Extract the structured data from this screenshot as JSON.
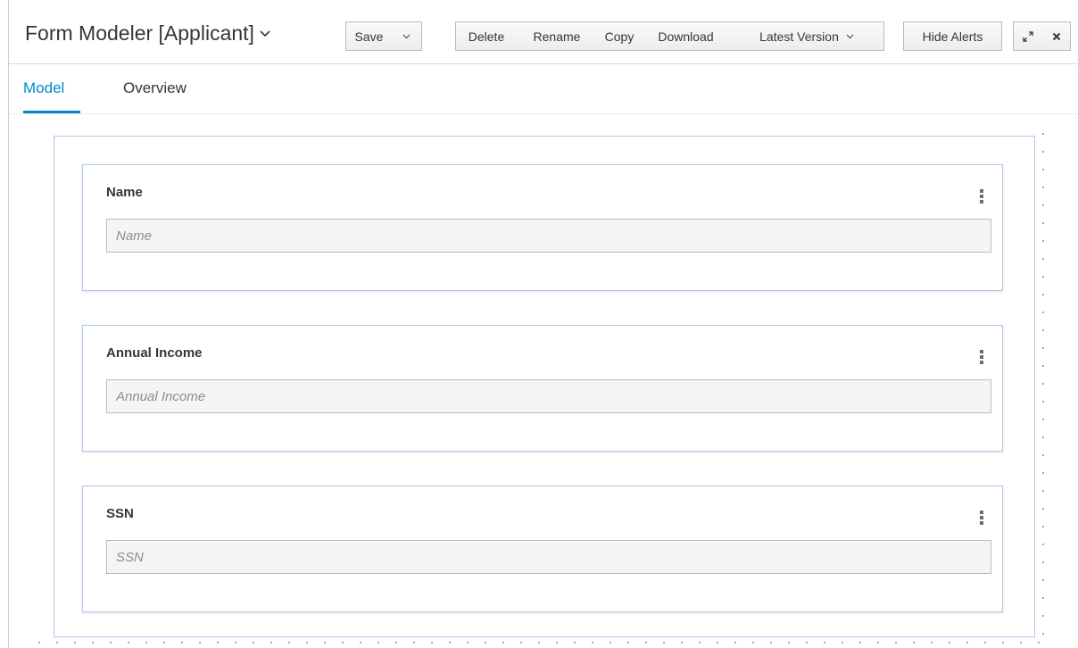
{
  "header": {
    "title": "Form Modeler [Applicant]",
    "buttons": {
      "save": "Save",
      "delete": "Delete",
      "rename": "Rename",
      "copy": "Copy",
      "download": "Download",
      "latest_version": "Latest Version",
      "hide_alerts": "Hide Alerts"
    },
    "icons": {
      "title_dropdown": "chevron-down-icon",
      "save_dropdown": "chevron-down-icon",
      "version_dropdown": "chevron-down-icon",
      "maximize": "expand-icon",
      "close": "close-icon"
    }
  },
  "tabs": [
    {
      "label": "Model",
      "active": true
    },
    {
      "label": "Overview",
      "active": false
    }
  ],
  "form": {
    "fields": [
      {
        "label": "Name",
        "placeholder": "Name"
      },
      {
        "label": "Annual Income",
        "placeholder": "Annual Income"
      },
      {
        "label": "SSN",
        "placeholder": "SSN"
      }
    ]
  },
  "colors": {
    "accent": "#0088ce",
    "card_border": "#aec8ea",
    "input_bg": "#f5f5f5"
  }
}
